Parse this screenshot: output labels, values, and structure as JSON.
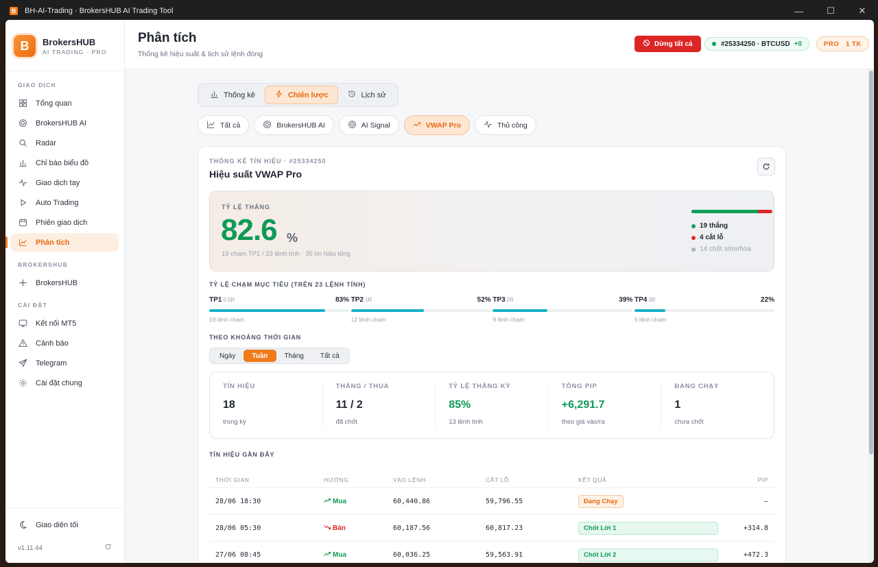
{
  "window": {
    "title": "BH-AI-Trading · BrokersHUB AI Trading Tool",
    "icon_letter": "B",
    "minimize": "—",
    "maximize": "☐",
    "close": "✕"
  },
  "brand": {
    "logo_letter": "B",
    "name": "BrokersHUB",
    "subtitle": "AI TRADING · PRO"
  },
  "sidebar": {
    "sections": [
      {
        "label": "GIAO DỊCH",
        "items": [
          {
            "label": "Tổng quan",
            "icon": "grid-icon"
          },
          {
            "label": "BrokersHUB AI",
            "icon": "target-icon"
          },
          {
            "label": "Radar",
            "icon": "search-icon"
          },
          {
            "label": "Chỉ báo biểu đồ",
            "icon": "bar-chart-icon"
          },
          {
            "label": "Giao dịch tay",
            "icon": "pulse-icon"
          },
          {
            "label": "Auto Trading",
            "icon": "play-icon"
          },
          {
            "label": "Phiên giao dịch",
            "icon": "calendar-icon"
          },
          {
            "label": "Phân tích",
            "icon": "line-chart-icon",
            "active": true
          }
        ]
      },
      {
        "label": "BROKERSHUB",
        "items": [
          {
            "label": "BrokersHUB",
            "icon": "plus-icon"
          }
        ]
      },
      {
        "label": "CÀI ĐẶT",
        "items": [
          {
            "label": "Kết nối MT5",
            "icon": "monitor-icon"
          },
          {
            "label": "Cảnh báo",
            "icon": "warning-icon"
          },
          {
            "label": "Telegram",
            "icon": "send-icon"
          },
          {
            "label": "Cài đặt chung",
            "icon": "gear-icon"
          }
        ]
      }
    ],
    "dark_mode_label": "Giao diện tối",
    "version": "v1.11.44"
  },
  "header": {
    "title": "Phân tích",
    "subtitle": "Thống kê hiệu suất & lịch sử lệnh đóng",
    "stop_all_label": "Dừng tất cả",
    "account_label": "#25334250 · BTCUSD",
    "account_delta": "+0",
    "plan": "PRO",
    "plan_count": "1 TK"
  },
  "tabs": [
    {
      "label": "Thống kê",
      "icon": "bar-chart-icon"
    },
    {
      "label": "Chiến lược",
      "icon": "bolt-icon",
      "active": true
    },
    {
      "label": "Lịch sử",
      "icon": "history-icon"
    }
  ],
  "filters": [
    {
      "label": "Tất cả",
      "icon": "line-chart-icon"
    },
    {
      "label": "BrokersHUB AI",
      "icon": "target-icon"
    },
    {
      "label": "AI Signal",
      "icon": "target-icon"
    },
    {
      "label": "VWAP Pro",
      "icon": "trend-icon",
      "active": true
    },
    {
      "label": "Thủ công",
      "icon": "pulse-icon"
    }
  ],
  "card": {
    "eyebrow": "THỐNG KÊ TÍN HIỆU · #25334250",
    "title": "Hiệu suất VWAP Pro",
    "winrate": {
      "label": "TỶ LỆ THẮNG",
      "value": "82.6",
      "unit": "%",
      "description": "19 chạm TP1 / 23 lệnh tính · 35 tín hiệu tổng",
      "win_fraction": 0.826,
      "legend": [
        {
          "label": "19 thắng",
          "color": "#10a05a"
        },
        {
          "label": "4 cắt lỗ",
          "color": "#dc2626"
        },
        {
          "label": "14 chốt sớm/hòa",
          "color": "#aab0bb",
          "muted": true
        }
      ]
    },
    "targets_title": "TỶ LỆ CHẠM MỤC TIÊU (TRÊN 23 LỆNH TÍNH)",
    "targets": [
      {
        "name": "TP1",
        "ratio": "0.5R",
        "percent_label": "83%",
        "percent": 83,
        "count": "19 lệnh chạm"
      },
      {
        "name": "TP2",
        "ratio": "1R",
        "percent_label": "52%",
        "percent": 52,
        "count": "12 lệnh chạm"
      },
      {
        "name": "TP3",
        "ratio": "2R",
        "percent_label": "39%",
        "percent": 39,
        "count": "9 lệnh chạm"
      },
      {
        "name": "TP4",
        "ratio": "3R",
        "percent_label": "22%",
        "percent": 22,
        "count": "5 lệnh chạm"
      }
    ],
    "period_title": "THEO KHOẢNG THỜI GIAN",
    "periods": [
      {
        "label": "Ngày"
      },
      {
        "label": "Tuần",
        "active": true
      },
      {
        "label": "Tháng"
      },
      {
        "label": "Tất cả"
      }
    ],
    "stats": [
      {
        "key": "TÍN HIỆU",
        "value": "18",
        "sub": "trong kỳ"
      },
      {
        "key": "THẮNG / THUA",
        "value": "11 / 2",
        "sub": "đã chốt"
      },
      {
        "key": "TỶ LỆ THẮNG KỲ",
        "value": "85%",
        "sub": "13 lệnh tính",
        "green": true
      },
      {
        "key": "TỔNG PIP",
        "value": "+6,291.7",
        "sub": "theo giá vào/ra",
        "green": true
      },
      {
        "key": "ĐANG CHẠY",
        "value": "1",
        "sub": "chưa chốt"
      }
    ],
    "recent_title": "TÍN HIỆU GẦN ĐÂY",
    "table": {
      "headers": [
        "THỜI GIAN",
        "HƯỚNG",
        "VÀO LỆNH",
        "CẮT LỖ",
        "KẾT QUẢ",
        "PIP"
      ],
      "rows": [
        {
          "time": "28/06 18:30",
          "direction": "Mua",
          "dir": "buy",
          "entry": "60,440.86",
          "sl": "59,796.55",
          "result": "Đang Chạy",
          "result_type": "run",
          "pip": "—"
        },
        {
          "time": "28/06 05:30",
          "direction": "Bán",
          "dir": "sell",
          "entry": "60,187.56",
          "sl": "60,817.23",
          "result": "Chốt Lời 1",
          "result_type": "tp",
          "pip": "+314.8"
        },
        {
          "time": "27/06 08:45",
          "direction": "Mua",
          "dir": "buy",
          "entry": "60,036.25",
          "sl": "59,563.91",
          "result": "Chốt Lời 2",
          "result_type": "tp",
          "pip": "+472.3"
        }
      ]
    }
  }
}
